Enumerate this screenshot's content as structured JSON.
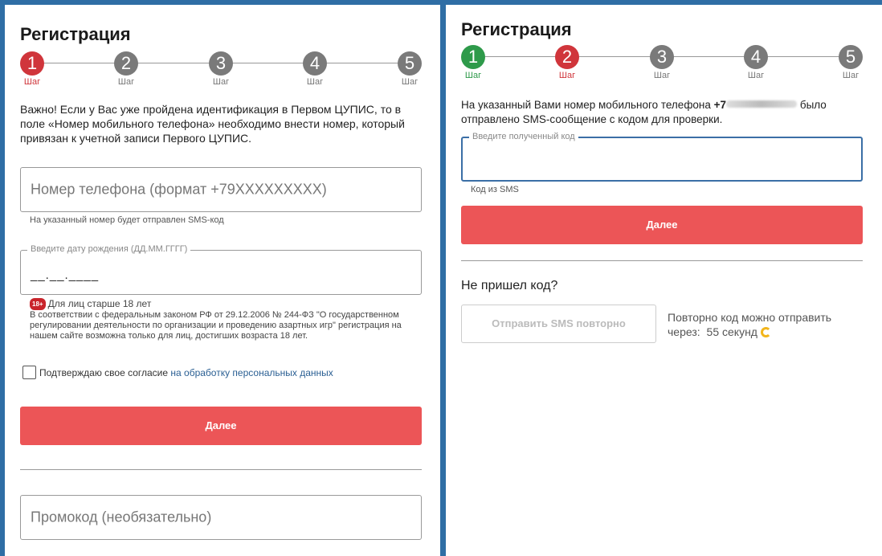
{
  "colors": {
    "accent_red": "#d0353b",
    "button_red": "#ec5557",
    "done_green": "#2e9a4a",
    "inactive_grey": "#7a7a7a",
    "frame_blue": "#2f6ea5"
  },
  "left": {
    "title": "Регистрация",
    "steps": [
      {
        "num": "1",
        "label": "Шаг",
        "state": "active"
      },
      {
        "num": "2",
        "label": "Шаг",
        "state": "inactive"
      },
      {
        "num": "3",
        "label": "Шаг",
        "state": "inactive"
      },
      {
        "num": "4",
        "label": "Шаг",
        "state": "inactive"
      },
      {
        "num": "5",
        "label": "Шаг",
        "state": "inactive"
      }
    ],
    "notice": "Важно! Если у Вас уже пройдена идентификация в Первом ЦУПИС, то в поле «Номер мобильного телефона» необходимо внести номер, который привязан к учетной записи Первого ЦУПИС.",
    "phone_placeholder": "Номер телефона (формат +79XXXXXXXXX)",
    "phone_hint": "На указанный номер будет отправлен SMS-код",
    "dob_label": "Введите дату рождения (ДД.ММ.ГГГГ)",
    "dob_value": "__.__.____",
    "age_badge": "18+",
    "age_title": "Для лиц старше 18 лет",
    "age_law": "В соответствии с федеральным законом РФ от 29.12.2006 № 244-ФЗ \"О государственном регулировании деятельности по организации и проведению азартных игр\" регистрация на нашем сайте возможна только для лиц, достигших возраста 18 лет.",
    "consent_text": "Подтверждаю свое согласие",
    "consent_link": "на обработку персональных данных",
    "next_button": "Далее",
    "promo_placeholder": "Промокод (необязательно)"
  },
  "right": {
    "title": "Регистрация",
    "steps": [
      {
        "num": "1",
        "label": "Шаг",
        "state": "done"
      },
      {
        "num": "2",
        "label": "Шаг",
        "state": "active"
      },
      {
        "num": "3",
        "label": "Шаг",
        "state": "inactive"
      },
      {
        "num": "4",
        "label": "Шаг",
        "state": "inactive"
      },
      {
        "num": "5",
        "label": "Шаг",
        "state": "inactive"
      }
    ],
    "sms_text_before": "На указанный Вами номер мобильного телефона",
    "sms_phone_prefix": "+7",
    "sms_text_after": "было отправлено SMS-сообщение с кодом для проверки.",
    "code_label": "Введите полученный код",
    "code_hint": "Код из SMS",
    "next_button": "Далее",
    "no_code_title": "Не пришел код?",
    "resend_button": "Отправить SMS повторно",
    "resend_info": "Повторно код можно отправить через:",
    "countdown": "55 секунд"
  }
}
